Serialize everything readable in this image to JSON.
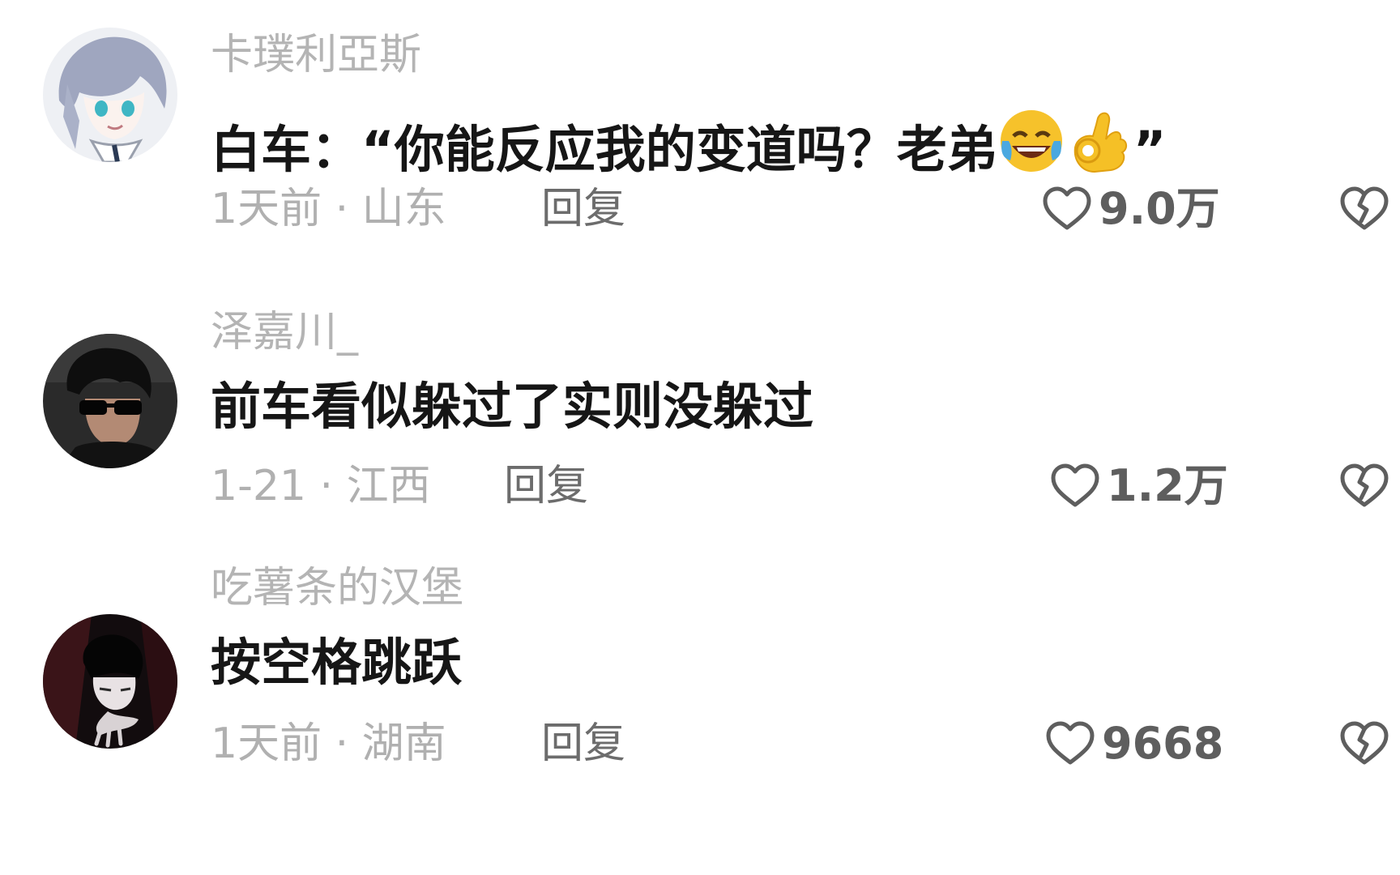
{
  "comments": [
    {
      "username": "卡璞利亞斯",
      "text": "白车：“你能反应我的变道吗？老弟",
      "text_end": "”",
      "emojis": [
        "rolling-laughing-emoji",
        "ok-hand-emoji"
      ],
      "meta": "1天前 · 山东",
      "reply_label": "回复",
      "likes": "9.0万"
    },
    {
      "username": "泽嘉川_",
      "text": "前车看似躲过了实则没躲过",
      "meta": "1-21 · 江西",
      "reply_label": "回复",
      "likes": "1.2万"
    },
    {
      "username": "吃薯条的汉堡",
      "text": "按空格跳跃",
      "meta": "1天前 · 湖南",
      "reply_label": "回复",
      "likes": "9668"
    }
  ],
  "icons": {
    "like": "heart-outline-icon",
    "dislike": "broken-heart-outline-icon"
  },
  "colors": {
    "username": "#b4b4b4",
    "text": "#161616",
    "meta": "#b0b0b0",
    "reply": "#6c6c6c",
    "icon": "#5e5e5e",
    "background": "#ffffff"
  }
}
